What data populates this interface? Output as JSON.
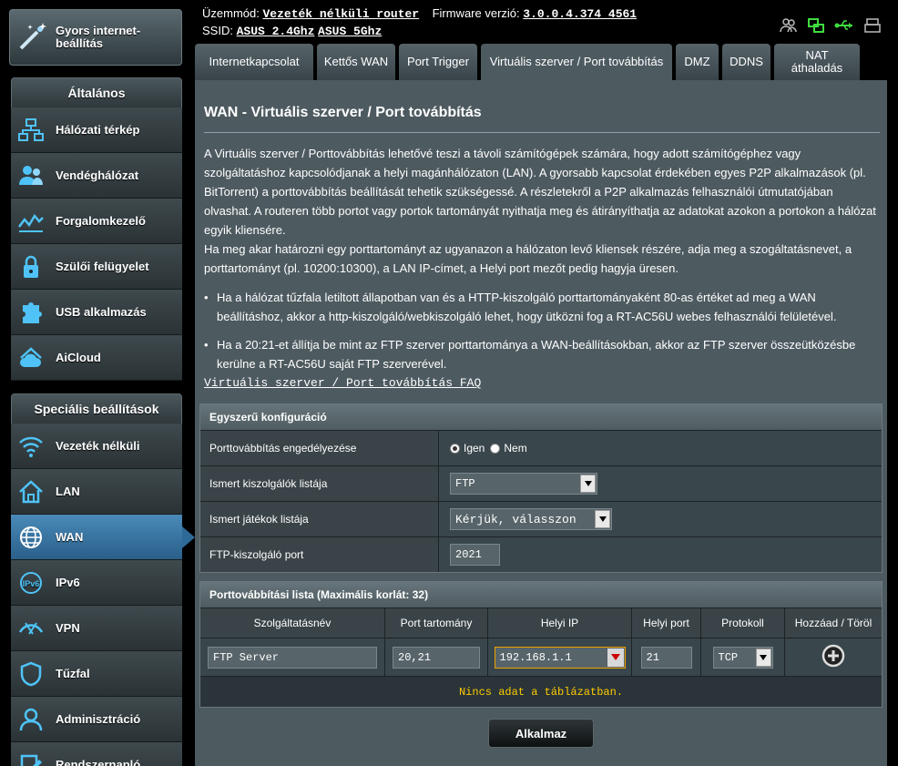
{
  "header": {
    "mode_label": "Üzemmód:",
    "mode_value": "Vezeték nélküli router",
    "firmware_label": "Firmware verzió:",
    "firmware_value": "3.0.0.4.374_4561",
    "ssid_label": "SSID:",
    "ssid_1": "ASUS_2.4Ghz",
    "ssid_2": "ASUS_5Ghz",
    "status_icons": [
      "users-icon",
      "network-icon",
      "usb-icon",
      "printer-icon"
    ]
  },
  "sidebar": {
    "quick_setup": "Gyors internet-beállítás",
    "general_title": "Általános",
    "general_items": [
      {
        "label": "Hálózati térkép",
        "icon": "network-map-icon"
      },
      {
        "label": "Vendéghálózat",
        "icon": "guest-network-icon"
      },
      {
        "label": "Forgalomkezelő",
        "icon": "traffic-manager-icon"
      },
      {
        "label": "Szülői felügyelet",
        "icon": "parental-lock-icon"
      },
      {
        "label": "USB alkalmazás",
        "icon": "usb-app-icon"
      },
      {
        "label": "AiCloud",
        "icon": "cloud-home-icon"
      }
    ],
    "advanced_title": "Speciális beállítások",
    "advanced_items": [
      {
        "label": "Vezeték nélküli",
        "icon": "wireless-icon"
      },
      {
        "label": "LAN",
        "icon": "home-icon"
      },
      {
        "label": "WAN",
        "icon": "globe-icon",
        "active": true
      },
      {
        "label": "IPv6",
        "icon": "ipv6-icon"
      },
      {
        "label": "VPN",
        "icon": "vpn-icon"
      },
      {
        "label": "Tűzfal",
        "icon": "firewall-shield-icon"
      },
      {
        "label": "Adminisztráció",
        "icon": "admin-user-icon"
      },
      {
        "label": "Rendszernapló",
        "icon": "system-log-icon"
      }
    ]
  },
  "tabs": [
    {
      "label": "Internetkapcsolat",
      "width": 124
    },
    {
      "label": "Kettős WAN",
      "width": 86
    },
    {
      "label": "Port Trigger",
      "width": 86
    },
    {
      "label": "Virtuális szerver / Port továbbítás",
      "width": 210,
      "active": true
    },
    {
      "label": "DMZ",
      "width": 44
    },
    {
      "label": "DDNS",
      "width": 52
    },
    {
      "label": "NAT áthaladás",
      "width": 94
    }
  ],
  "page": {
    "title": "WAN - Virtuális szerver / Port továbbítás",
    "description_1": "A Virtuális szerver / Porttovábbítás lehetővé teszi a távoli számítógépek számára, hogy adott számítógéphez vagy szolgáltatáshoz kapcsolódjanak a helyi magánhálózaton (LAN). A gyorsabb kapcsolat érdekében egyes P2P alkalmazások (pl. BitTorrent) a porttovábbítás beállítását tehetik szükségessé. A részletekről a P2P alkalmazás felhasználói útmutatójában olvashat. A routeren több portot vagy portok tartományát nyithatja meg és átirányíthatja az adatokat azokon a portokon a hálózat egyik kliensére.",
    "description_2": "Ha meg akar határozni egy porttartományt az ugyanazon a hálózaton levő kliensek részére, adja meg a szogáltatásnevet, a porttartományt (pl. 10200:10300), a LAN IP-címet, a Helyi port mezőt pedig hagyja üresen.",
    "bullet_1": "Ha a hálózat tűzfala letiltott állapotban van és a HTTP-kiszolgáló porttartományaként 80-as értéket ad meg a WAN beállításhoz, akkor a http-kiszolgáló/webkiszolgáló lehet, hogy ütközni fog a RT-AC56U webes felhasználói felületével.",
    "bullet_2": "Ha a 20:21-et állítja be mint az FTP szerver porttartománya a WAN-beállításokban, akkor az FTP szerver összeütközésbe kerülne a RT-AC56U saját FTP szerverével.",
    "faq_link": "Virtuális szerver / Port továbbítás FAQ"
  },
  "basic_config": {
    "title": "Egyszerű konfiguráció",
    "enable_label": "Porttovábbítás engedélyezése",
    "yes_label": "Igen",
    "no_label": "Nem",
    "servers_label": "Ismert kiszolgálók listája",
    "servers_value": "FTP",
    "games_label": "Ismert játékok listája",
    "games_value": "Kérjük, válasszon",
    "ftp_port_label": "FTP-kiszolgáló port",
    "ftp_port_value": "2021"
  },
  "port_list": {
    "title": "Porttovábbítási lista (Maximális korlát: 32)",
    "col_service": "Szolgáltatásnév",
    "col_range": "Port tartomány",
    "col_ip": "Helyi IP",
    "col_local_port": "Helyi port",
    "col_protocol": "Protokoll",
    "col_add": "Hozzáad / Töröl",
    "service_value": "FTP Server",
    "range_value": "20,21",
    "ip_value": "192.168.1.1",
    "local_port_value": "21",
    "protocol_value": "TCP",
    "empty_text": "Nincs adat a táblázatban."
  },
  "apply_label": "Alkalmaz"
}
